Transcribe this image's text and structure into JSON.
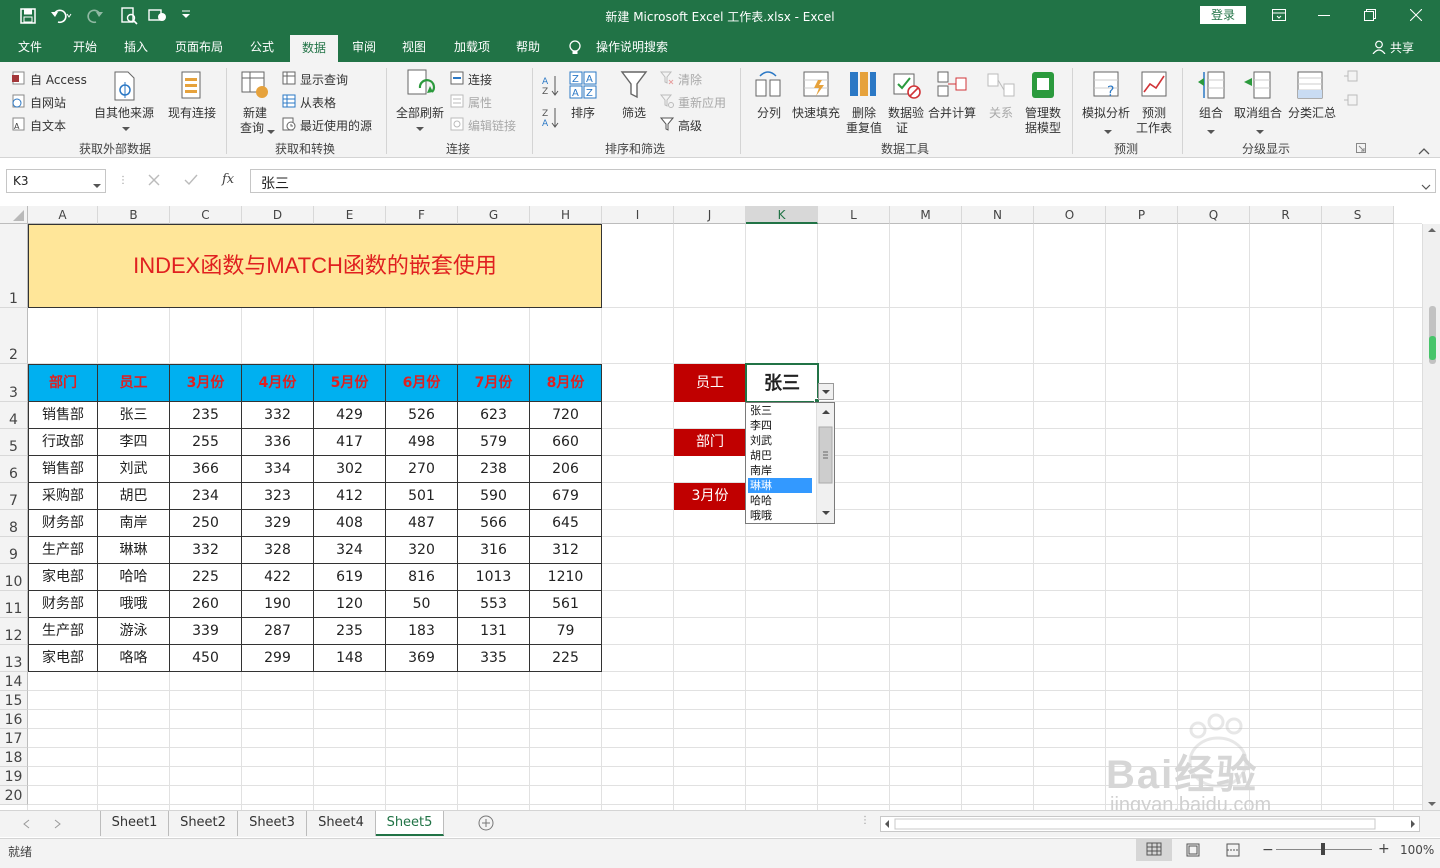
{
  "window": {
    "title": "新建 Microsoft Excel 工作表.xlsx  -  Excel",
    "login": "登录",
    "share": "共享"
  },
  "tabs": [
    "文件",
    "开始",
    "插入",
    "页面布局",
    "公式",
    "数据",
    "审阅",
    "视图",
    "加载项",
    "帮助",
    "操作说明搜索"
  ],
  "active_tab": "数据",
  "ribbon": {
    "get_external": {
      "label": "获取外部数据",
      "access": "自 Access",
      "web": "自网站",
      "text": "自文本",
      "other": "自其他来源",
      "existing": "现有连接"
    },
    "get_transform": {
      "label": "获取和转换",
      "new_query_1": "新建",
      "new_query_2": "查询",
      "show_queries": "显示查询",
      "from_table": "从表格",
      "recent_sources": "最近使用的源"
    },
    "connections": {
      "label": "连接",
      "refresh_all": "全部刷新",
      "connections": "连接",
      "properties": "属性",
      "edit_links": "编辑链接"
    },
    "sort_filter": {
      "label": "排序和筛选",
      "sort": "排序",
      "filter": "筛选",
      "clear": "清除",
      "reapply": "重新应用",
      "advanced": "高级"
    },
    "data_tools": {
      "label": "数据工具",
      "split": "分列",
      "flash_fill": "快速填充",
      "remove_dup_1": "删除",
      "remove_dup_2": "重复值",
      "validation_1": "数据验",
      "validation_2": "证",
      "consolidate": "合并计算",
      "relations": "关系",
      "data_model_1": "管理数",
      "data_model_2": "据模型"
    },
    "forecast": {
      "label": "预测",
      "whatif": "模拟分析",
      "sheet_1": "预测",
      "sheet_2": "工作表"
    },
    "outline": {
      "label": "分级显示",
      "group": "组合",
      "ungroup": "取消组合",
      "subtotal": "分类汇总"
    }
  },
  "formula_bar": {
    "name_box": "K3",
    "fx": "fx",
    "content": "张三"
  },
  "columns": [
    "A",
    "B",
    "C",
    "D",
    "E",
    "F",
    "G",
    "H",
    "I",
    "J",
    "K",
    "L",
    "M",
    "N",
    "O",
    "P",
    "Q",
    "R",
    "S"
  ],
  "rows": [
    "1",
    "2",
    "3",
    "4",
    "5",
    "6",
    "7",
    "8",
    "9",
    "10",
    "11",
    "12",
    "13",
    "14",
    "15",
    "16",
    "17",
    "18",
    "19",
    "20"
  ],
  "sheet": {
    "title": "INDEX函数与MATCH函数的嵌套使用",
    "headers": [
      "部门",
      "员工",
      "3月份",
      "4月份",
      "5月份",
      "6月份",
      "7月份",
      "8月份"
    ],
    "table_rows": [
      [
        "销售部",
        "张三",
        "235",
        "332",
        "429",
        "526",
        "623",
        "720"
      ],
      [
        "行政部",
        "李四",
        "255",
        "336",
        "417",
        "498",
        "579",
        "660"
      ],
      [
        "销售部",
        "刘武",
        "366",
        "334",
        "302",
        "270",
        "238",
        "206"
      ],
      [
        "采购部",
        "胡巴",
        "234",
        "323",
        "412",
        "501",
        "590",
        "679"
      ],
      [
        "财务部",
        "南岸",
        "250",
        "329",
        "408",
        "487",
        "566",
        "645"
      ],
      [
        "生产部",
        "琳琳",
        "332",
        "328",
        "324",
        "320",
        "316",
        "312"
      ],
      [
        "家电部",
        "哈哈",
        "225",
        "422",
        "619",
        "816",
        "1013",
        "1210"
      ],
      [
        "财务部",
        "哦哦",
        "260",
        "190",
        "120",
        "50",
        "553",
        "561"
      ],
      [
        "生产部",
        "游泳",
        "339",
        "287",
        "235",
        "183",
        "131",
        "79"
      ],
      [
        "家电部",
        "咯咯",
        "450",
        "299",
        "148",
        "369",
        "335",
        "225"
      ]
    ],
    "lookup_labels": [
      "员工",
      "部门",
      "3月份"
    ],
    "lookup_value": "张三",
    "dropdown_items": [
      "张三",
      "李四",
      "刘武",
      "胡巴",
      "南岸",
      "琳琳",
      "哈哈",
      "哦哦"
    ],
    "dropdown_highlighted": "琳琳"
  },
  "sheet_tabs": [
    "Sheet1",
    "Sheet2",
    "Sheet3",
    "Sheet4",
    "Sheet5"
  ],
  "active_sheet": "Sheet5",
  "status": {
    "ready": "就绪",
    "zoom": "100%"
  },
  "watermark": {
    "brand": "Bai经验",
    "url": "jingyan.baidu.com"
  },
  "colors": {
    "excel_green": "#217346",
    "title_fill": "#ffe699",
    "title_text": "#e02020",
    "header_fill": "#00b0f0",
    "label_fill": "#c00000"
  }
}
